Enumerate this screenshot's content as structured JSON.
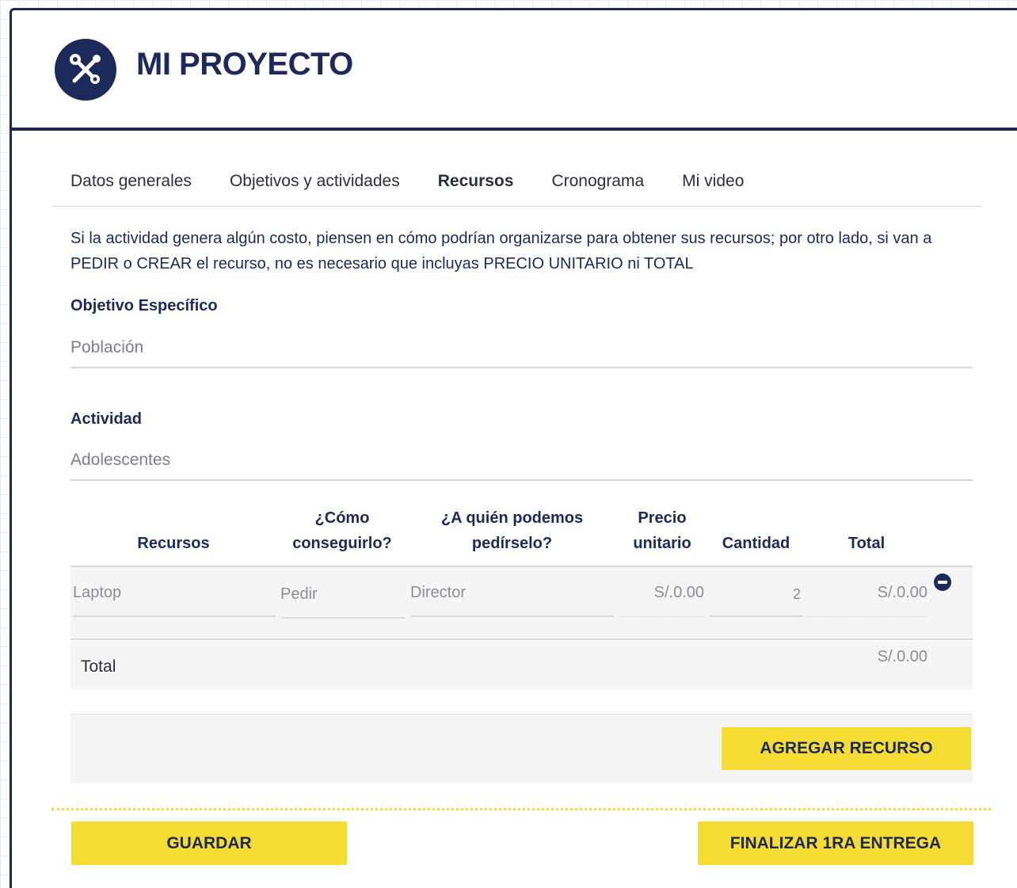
{
  "header": {
    "title": "MI PROYECTO",
    "logo_icon": "tools-icon",
    "accent": "#1c2a5b"
  },
  "tabs": [
    {
      "label": "Datos generales",
      "active": false
    },
    {
      "label": "Objetivos y actividades",
      "active": false
    },
    {
      "label": "Recursos",
      "active": true
    },
    {
      "label": "Cronograma",
      "active": false
    },
    {
      "label": "Mi video",
      "active": false
    }
  ],
  "info_text": "Si la actividad genera algún costo, piensen en cómo podrían organizarse para obtener sus recursos; por otro lado, si van a PEDIR o CREAR el recurso, no es necesario que incluyas PRECIO UNITARIO ni TOTAL",
  "objetivo": {
    "label": "Objetivo Específico",
    "value": "Población"
  },
  "actividad": {
    "label": "Actividad",
    "value": "Adolescentes"
  },
  "table": {
    "headers": {
      "recursos": "Recursos",
      "como_1": "¿Cómo",
      "como_2": "conseguirlo?",
      "quien_1": "¿A quién podemos",
      "quien_2": "pedírselo?",
      "precio_1": "Precio",
      "precio_2": "unitario",
      "cantidad": "Cantidad",
      "total": "Total"
    },
    "rows": [
      {
        "recurso": "Laptop",
        "como": "Pedir",
        "quien": "Director",
        "precio": "S/.0.00",
        "cantidad": "2",
        "total": "S/.0.00"
      }
    ],
    "total_label": "Total",
    "total_value": "S/.0.00"
  },
  "buttons": {
    "agregar": "AGREGAR RECURSO",
    "guardar": "GUARDAR",
    "finalizar": "FINALIZAR 1RA ENTREGA"
  },
  "colors": {
    "primary": "#1c2a5b",
    "button_yellow": "#f5dc32"
  }
}
